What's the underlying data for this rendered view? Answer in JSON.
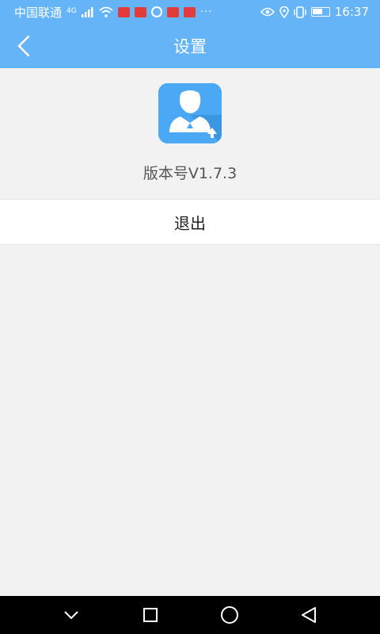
{
  "status_bar": {
    "carrier": "中国联通",
    "network": "4G",
    "more": "···",
    "time": "16:37"
  },
  "header": {
    "title": "设置"
  },
  "about": {
    "version_label": "版本号V1.7.3"
  },
  "actions": {
    "logout_label": "退出"
  },
  "colors": {
    "accent": "#64b4f7",
    "background": "#f2f2f2",
    "nav_background": "#000000"
  },
  "icons": {
    "back": "chevron-left-icon",
    "app": "user-avatar-icon",
    "nav_down": "chevron-down-icon",
    "nav_recent": "square-icon",
    "nav_home": "circle-icon",
    "nav_back": "triangle-back-icon"
  }
}
